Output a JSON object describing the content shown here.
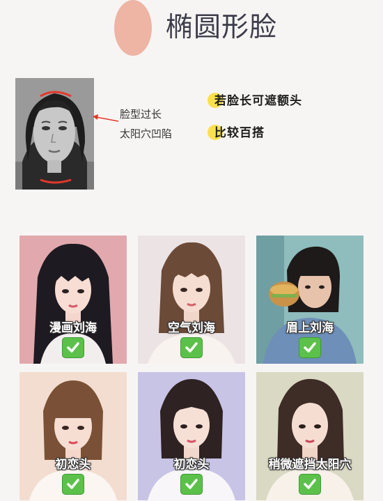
{
  "header": {
    "title": "椭圆形脸",
    "accent_color": "#eeb4a4"
  },
  "reference": {
    "annotation_line1": "脸型过长",
    "annotation_line2": "太阳穴凹陷",
    "marker_color": "#e3382c"
  },
  "notes": [
    {
      "text": "若脸长可遮额头"
    },
    {
      "text": "比较百搭"
    }
  ],
  "cards": [
    {
      "label": "漫画刘海",
      "check": "check-mark-icon"
    },
    {
      "label": "空气刘海",
      "check": "check-mark-icon"
    },
    {
      "label": "眉上刘海",
      "check": "check-mark-icon"
    },
    {
      "label": "初恋头",
      "check": "check-mark-icon"
    },
    {
      "label": "初恋头",
      "check": "check-mark-icon"
    },
    {
      "label": "稍微遮挡太阳穴",
      "check": "check-mark-icon"
    }
  ]
}
